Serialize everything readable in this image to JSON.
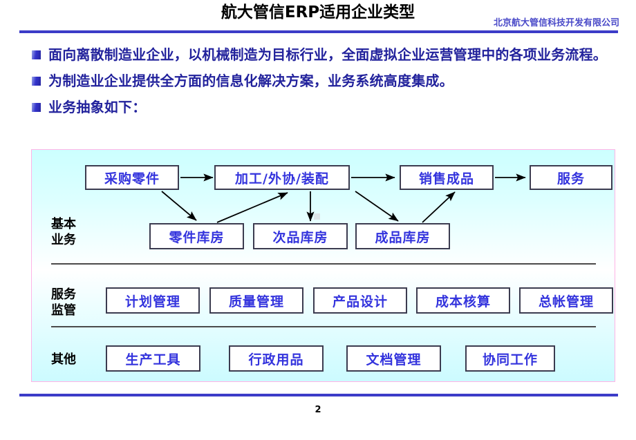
{
  "header": {
    "title": "航大管信ERP适用企业类型",
    "company": "北京航大管信科技开发有限公司"
  },
  "bullets": [
    {
      "marker": "square-bullet-icon",
      "text": "面向离散制造业企业，以机械制造为目标行业，全面虚拟企业运营管理中的各项业务流程。"
    },
    {
      "marker": "square-bullet-icon",
      "text": "为制造业企业提供全方面的信息化解决方案，业务系统高度集成。"
    },
    {
      "marker": "square-bullet-icon",
      "text": "业务抽象如下："
    }
  ],
  "diagram": {
    "rows": [
      {
        "label": "基本\n业务",
        "nodes": [
          {
            "id": "purchase-parts",
            "label": "采购零件"
          },
          {
            "id": "process-outsource-assemble",
            "label": "加工/外协/装配"
          },
          {
            "id": "sell-products",
            "label": "销售成品"
          },
          {
            "id": "service",
            "label": "服务"
          },
          {
            "id": "parts-warehouse",
            "label": "零件库房"
          },
          {
            "id": "defect-warehouse",
            "label": "次品库房"
          },
          {
            "id": "finished-warehouse",
            "label": "成品库房"
          }
        ]
      },
      {
        "label": "服务\n监管",
        "nodes": [
          {
            "id": "plan-management",
            "label": "计划管理"
          },
          {
            "id": "quality-management",
            "label": "质量管理"
          },
          {
            "id": "product-design",
            "label": "产品设计"
          },
          {
            "id": "cost-accounting",
            "label": "成本核算"
          },
          {
            "id": "ledger-management",
            "label": "总帐管理"
          }
        ]
      },
      {
        "label": "其他",
        "nodes": [
          {
            "id": "production-tools",
            "label": "生产工具"
          },
          {
            "id": "admin-supplies",
            "label": "行政用品"
          },
          {
            "id": "document-management",
            "label": "文档管理"
          },
          {
            "id": "collaborative-work",
            "label": "协同工作"
          }
        ]
      }
    ],
    "flows": [
      {
        "from": "采购零件",
        "to": "加工/外协/装配"
      },
      {
        "from": "加工/外协/装配",
        "to": "销售成品"
      },
      {
        "from": "销售成品",
        "to": "服务"
      },
      {
        "from": "采购零件",
        "to": "零件库房"
      },
      {
        "from": "零件库房",
        "to": "加工/外协/装配"
      },
      {
        "from": "加工/外协/装配",
        "to": "次品库房"
      },
      {
        "from": "加工/外协/装配",
        "to": "成品库房"
      },
      {
        "from": "成品库房",
        "to": "销售成品"
      }
    ]
  },
  "footer": {
    "page_number": "2"
  },
  "colors": {
    "accent_blue": "#3c3cc8",
    "node_text": "#3333dd",
    "bullet_text": "#22229c",
    "panel_border": "#ffb3e6",
    "panel_top": "#ccffff"
  }
}
